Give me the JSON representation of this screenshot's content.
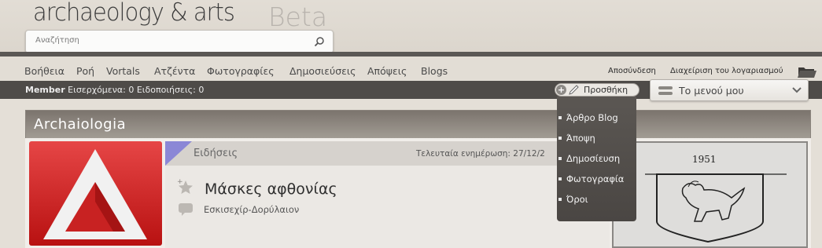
{
  "header": {
    "logo": "archaeology & arts",
    "beta": "Beta",
    "search_placeholder": "Αναζήτηση"
  },
  "nav": {
    "items": [
      {
        "label": "Βοήθεια"
      },
      {
        "label": "Ροή"
      },
      {
        "label": "Vortals"
      },
      {
        "label": "Ατζέντα"
      },
      {
        "label": "Φωτογραφίες"
      },
      {
        "label": "Δημοσιεύσεις"
      },
      {
        "label": "Απόψεις"
      },
      {
        "label": "Blogs"
      }
    ],
    "logout": "Αποσύνδεση",
    "account": "Διαχείριση του λογαριασμού"
  },
  "status": {
    "member": "Member",
    "inbox_label": "Εισερχόμενα:",
    "inbox_count": "0",
    "notifications_label": "Ειδοποιήσεις:",
    "notifications_count": "0"
  },
  "add_button": {
    "label": "Προσθήκη"
  },
  "dropdown": {
    "items": [
      {
        "label": "Άρθρο Blog"
      },
      {
        "label": "Άποψη"
      },
      {
        "label": "Δημοσίευση"
      },
      {
        "label": "Φωτογραφία"
      },
      {
        "label": "Όροι"
      }
    ]
  },
  "my_menu": {
    "label": "Το μενού μου"
  },
  "panel": {
    "title": "Archaiologia",
    "section_label": "Ειδήσεις",
    "last_updated": "Τελευταία ενημέρωση: 27/12/2",
    "article_title": "Μάσκες αφθονίας",
    "article_subtitle": "Εσκισεχίρ-Δορύλαιον"
  },
  "right_image": {
    "year": "1951"
  },
  "colors": {
    "header_bg": "#e2ddd5",
    "dark_bar": "#4e4b48",
    "title_bar": "#8c857d",
    "brand_red": "#c41e1e"
  }
}
